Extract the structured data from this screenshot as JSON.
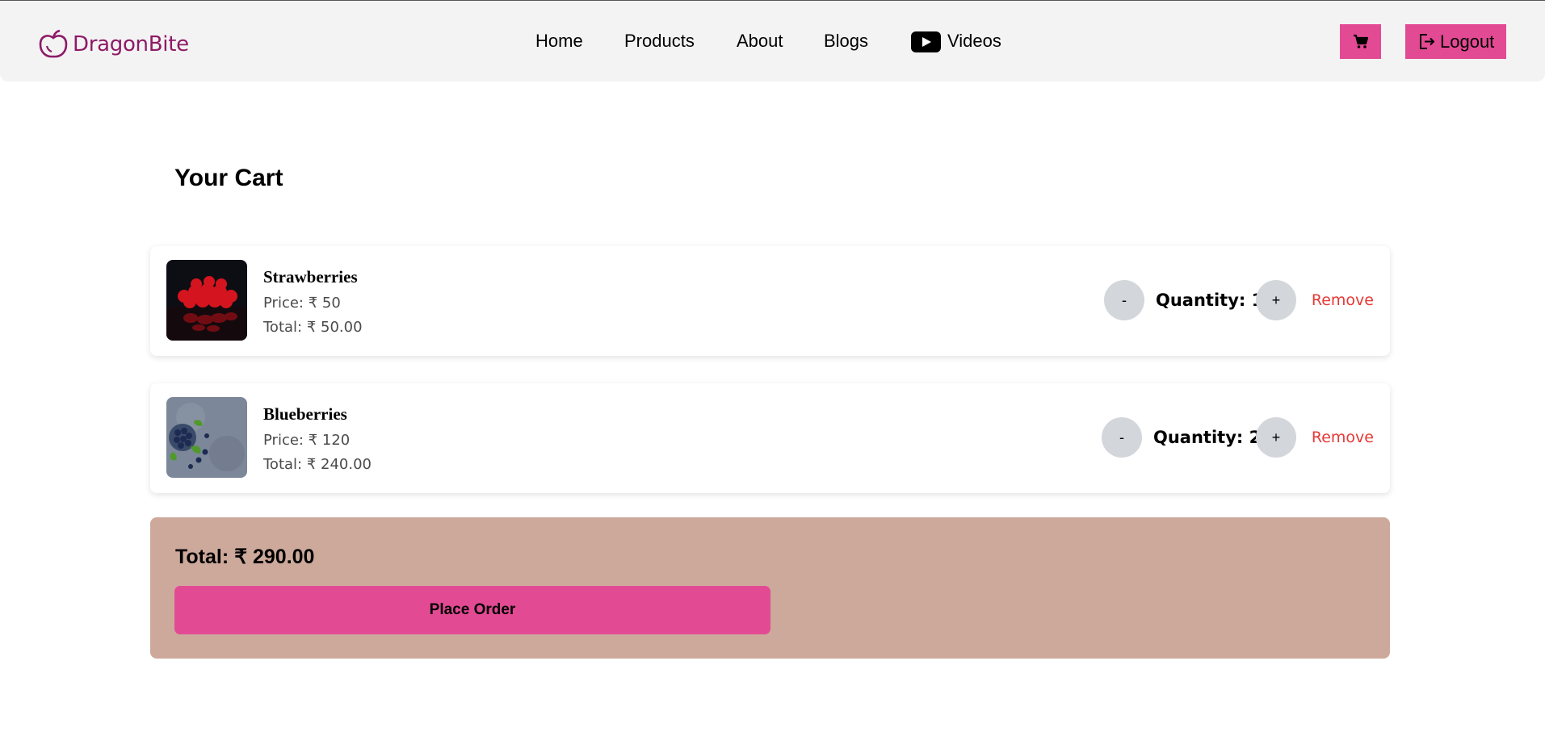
{
  "brand": {
    "name": "DragonBite",
    "color": "#8e1a66"
  },
  "nav": {
    "items": [
      {
        "label": "Home"
      },
      {
        "label": "Products"
      },
      {
        "label": "About"
      },
      {
        "label": "Blogs"
      },
      {
        "label": "Videos",
        "icon": "youtube-icon"
      }
    ]
  },
  "header": {
    "cart_icon": "cart-icon",
    "logout_label": "Logout",
    "logout_icon": "logout-icon",
    "accent": "#e34a94"
  },
  "cart": {
    "title": "Your Cart",
    "items": [
      {
        "name": "Strawberries",
        "price": "Price: ₹ 50",
        "total": "Total: ₹ 50.00",
        "quantity": "Quantity: 1",
        "decrement": "-",
        "increment": "+",
        "remove": "Remove",
        "image": "strawberries-image"
      },
      {
        "name": "Blueberries",
        "price": "Price: ₹ 120",
        "total": "Total: ₹ 240.00",
        "quantity": "Quantity: 2",
        "decrement": "-",
        "increment": "+",
        "remove": "Remove",
        "image": "blueberries-image"
      }
    ],
    "summary": {
      "total": "Total: ₹ 290.00",
      "place_order": "Place Order",
      "bg": "#cda99b"
    }
  }
}
